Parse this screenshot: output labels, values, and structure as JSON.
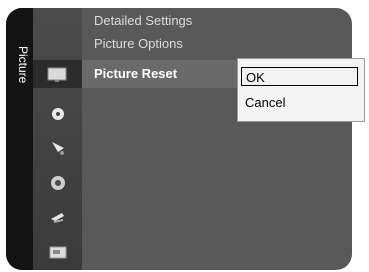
{
  "menu": {
    "side_label": "Picture",
    "items": [
      "Detailed Settings",
      "Picture Options"
    ],
    "active_item": "Picture Reset"
  },
  "dialog": {
    "options": [
      "OK",
      "Cancel"
    ]
  },
  "icons": [
    "picture-icon",
    "sound-icon",
    "channel-icon",
    "setup-icon",
    "input-icon",
    "application-icon"
  ],
  "colors": {
    "panel": "#595959",
    "sidebar": "#141414",
    "dialog": "#f3f3f3"
  }
}
